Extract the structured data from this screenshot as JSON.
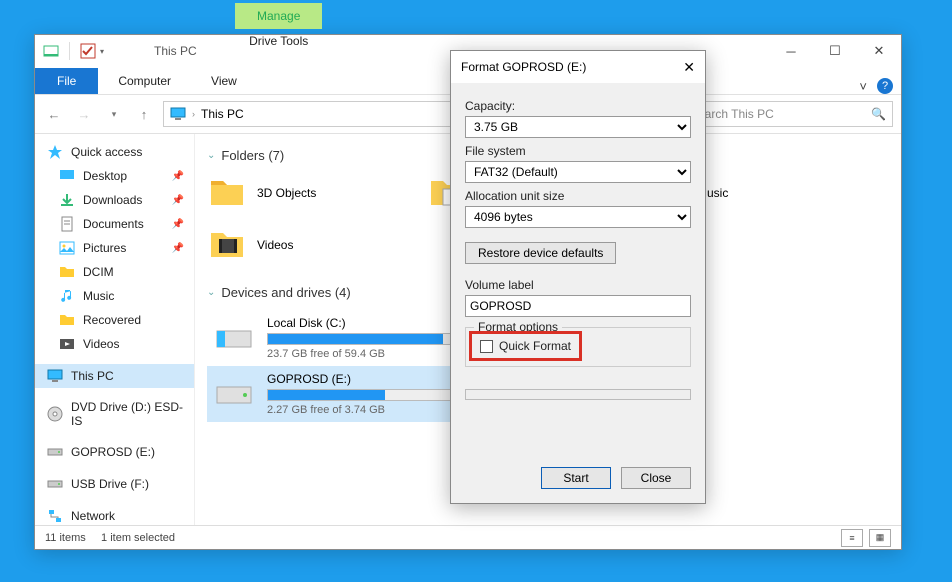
{
  "titlebar": {
    "title": "This PC"
  },
  "ribbon": {
    "file": "File",
    "computer": "Computer",
    "view": "View",
    "manage_header": "Manage",
    "drive_tools": "Drive Tools"
  },
  "addressbar": {
    "path": "This PC"
  },
  "search": {
    "placeholder": "Search This PC"
  },
  "sidebar": {
    "quick_access": "Quick access",
    "items": [
      {
        "label": "Desktop",
        "pinned": true
      },
      {
        "label": "Downloads",
        "pinned": true
      },
      {
        "label": "Documents",
        "pinned": true
      },
      {
        "label": "Pictures",
        "pinned": true
      },
      {
        "label": "DCIM",
        "pinned": false
      },
      {
        "label": "Music",
        "pinned": false
      },
      {
        "label": "Recovered",
        "pinned": false
      },
      {
        "label": "Videos",
        "pinned": false
      }
    ],
    "this_pc": "This PC",
    "dvd": "DVD Drive (D:) ESD-IS",
    "goprosd": "GOPROSD (E:)",
    "usb": "USB Drive (F:)",
    "network": "Network"
  },
  "content": {
    "folders_header": "Folders (7)",
    "folders": [
      "3D Objects",
      "Documents",
      "Music",
      "Videos"
    ],
    "drives_header": "Devices and drives (4)",
    "drives": [
      {
        "name": "Local Disk (C:)",
        "sub": "23.7 GB free of 59.4 GB",
        "fill": 60,
        "sel": false
      },
      {
        "name": "GOPROSD (E:)",
        "sub": "2.27 GB free of 3.74 GB",
        "fill": 40,
        "sel": true
      }
    ]
  },
  "statusbar": {
    "left1": "11 items",
    "left2": "1 item selected"
  },
  "dialog": {
    "title": "Format GOPROSD (E:)",
    "capacity_label": "Capacity:",
    "capacity_value": "3.75 GB",
    "fs_label": "File system",
    "fs_value": "FAT32 (Default)",
    "alloc_label": "Allocation unit size",
    "alloc_value": "4096 bytes",
    "restore_btn": "Restore device defaults",
    "vol_label": "Volume label",
    "vol_value": "GOPROSD",
    "fmt_options": "Format options",
    "quick_format": "Quick Format",
    "start": "Start",
    "close": "Close"
  }
}
